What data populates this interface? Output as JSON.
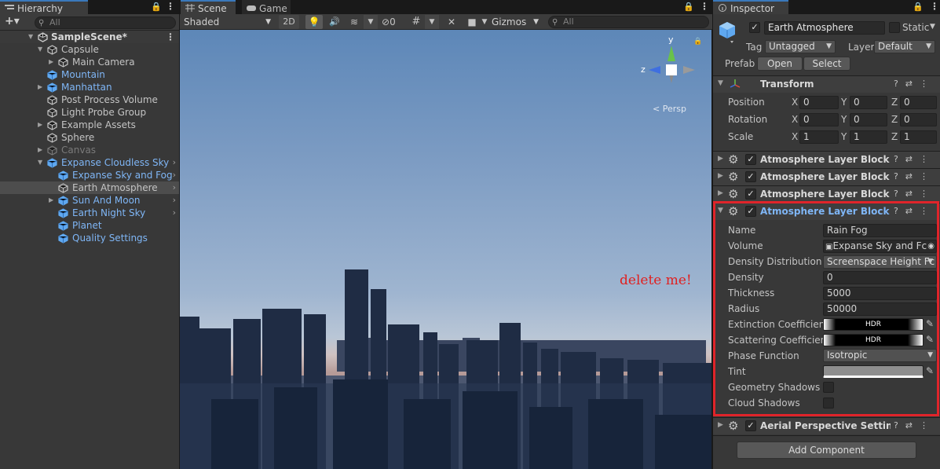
{
  "hierarchy": {
    "tab": "Hierarchy",
    "search_placeholder": "All",
    "add_label": "+▾",
    "scene_name": "SampleScene*",
    "items": [
      {
        "label": "Capsule",
        "color": "normal",
        "indent": 1,
        "expanded": true
      },
      {
        "label": "Main Camera",
        "color": "normal",
        "indent": 2,
        "arrow": true
      },
      {
        "label": "Mountain",
        "color": "blue",
        "indent": 1
      },
      {
        "label": "Manhattan",
        "color": "blue",
        "indent": 1,
        "arrow": true
      },
      {
        "label": "Post Process Volume",
        "color": "normal",
        "indent": 1
      },
      {
        "label": "Light Probe Group",
        "color": "normal",
        "indent": 1
      },
      {
        "label": "Example Assets",
        "color": "normal",
        "indent": 1,
        "arrow": true
      },
      {
        "label": "Sphere",
        "color": "normal",
        "indent": 1
      },
      {
        "label": "Canvas",
        "color": "grey",
        "indent": 1,
        "arrow": true
      },
      {
        "label": "Expanse Cloudless Sky",
        "color": "blue",
        "indent": 1,
        "expanded": true,
        "chevron": true
      },
      {
        "label": "Expanse Sky and Fog",
        "color": "blue",
        "indent": 2,
        "chevron": true
      },
      {
        "label": "Earth Atmosphere",
        "color": "normal",
        "indent": 2,
        "chevron": true,
        "selected": true
      },
      {
        "label": "Sun And Moon",
        "color": "blue",
        "indent": 2,
        "arrow": true,
        "chevron": true
      },
      {
        "label": "Earth Night Sky",
        "color": "blue",
        "indent": 2,
        "chevron": true
      },
      {
        "label": "Planet",
        "color": "blue",
        "indent": 2
      },
      {
        "label": "Quality Settings",
        "color": "blue",
        "indent": 2
      }
    ]
  },
  "scene": {
    "tabs": [
      "Scene",
      "Game"
    ],
    "shading": "Shaded",
    "mode_2d": "2D",
    "hidden_count": "0",
    "gizmos": "Gizmos",
    "search_placeholder": "All",
    "persp": "Persp",
    "axis_y": "y",
    "axis_z": "z"
  },
  "inspector": {
    "tab": "Inspector",
    "object_name": "Earth Atmosphere",
    "static_label": "Static",
    "tag_label": "Tag",
    "tag_value": "Untagged",
    "layer_label": "Layer",
    "layer_value": "Default",
    "prefab_label": "Prefab",
    "open_label": "Open",
    "select_label": "Select",
    "transform": {
      "title": "Transform",
      "rows": [
        {
          "label": "Position",
          "x": "0",
          "y": "0",
          "z": "0"
        },
        {
          "label": "Rotation",
          "x": "0",
          "y": "0",
          "z": "0"
        },
        {
          "label": "Scale",
          "x": "1",
          "y": "1",
          "z": "1"
        }
      ]
    },
    "collapsed_blocks": [
      "Atmosphere Layer Block (Sc",
      "Atmosphere Layer Block (Sc",
      "Atmosphere Layer Block (Sc"
    ],
    "expanded_block": {
      "title": "Atmosphere Layer Block (Sc",
      "name_label": "Name",
      "name_value": "Rain Fog",
      "volume_label": "Volume",
      "volume_value": "Expanse Sky and Fc",
      "density_dist_label": "Density Distribution",
      "density_dist_value": "Screenspace Height Fc",
      "density_label": "Density",
      "density_value": "0",
      "thickness_label": "Thickness",
      "thickness_value": "5000",
      "radius_label": "Radius",
      "radius_value": "50000",
      "extinction_label": "Extinction Coefficient",
      "scattering_label": "Scattering Coefficien",
      "hdr": "HDR",
      "phase_label": "Phase Function",
      "phase_value": "Isotropic",
      "tint_label": "Tint",
      "geometry_shadows_label": "Geometry Shadows",
      "cloud_shadows_label": "Cloud Shadows"
    },
    "aerial_title": "Aerial Perspective Settings",
    "add_component": "Add Component"
  },
  "annotation": {
    "text": "delete me!",
    "color": "#e02020"
  },
  "colors": {
    "highlight_box": "#e0242a",
    "tab_accent": "#3a79bb",
    "prefab_blue": "#7fb6f6"
  }
}
